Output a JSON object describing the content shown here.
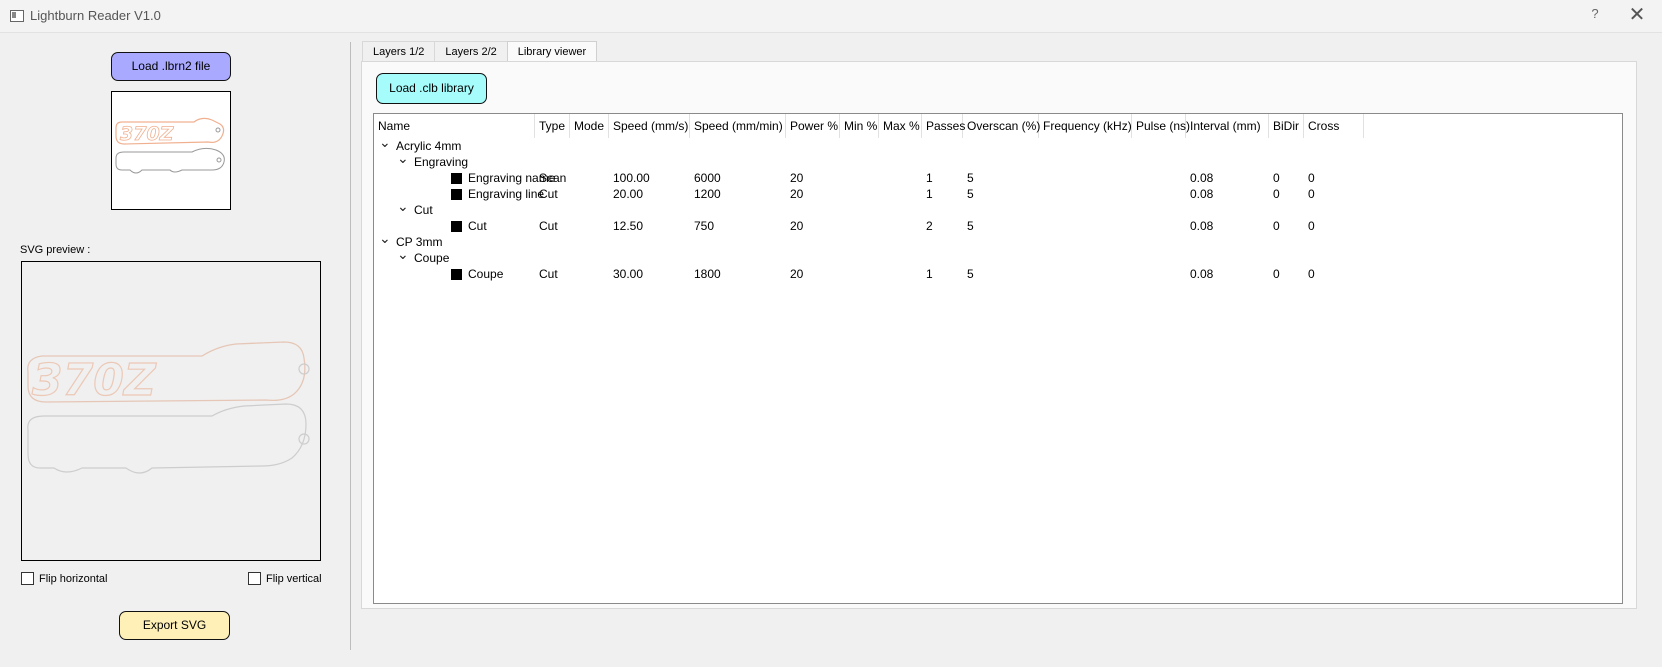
{
  "window": {
    "title": "Lightburn Reader V1.0",
    "help_label": "?",
    "close_label": "✕"
  },
  "left": {
    "load_button": "Load .lbrn2 file",
    "svg_preview_label": "SVG preview :",
    "flip_horizontal": "Flip horizontal",
    "flip_vertical": "Flip vertical",
    "export_button": "Export SVG"
  },
  "tabs": [
    {
      "label": "Layers 1/2",
      "active": false
    },
    {
      "label": "Layers 2/2",
      "active": false
    },
    {
      "label": "Library viewer",
      "active": true
    }
  ],
  "library": {
    "load_button": "Load .clb library",
    "columns": [
      "Name",
      "Type",
      "Mode",
      "Speed (mm/s)",
      "Speed (mm/min)",
      "Power %",
      "Min %",
      "Max %",
      "Passes",
      "Overscan (%)",
      "Frequency (kHz)",
      "Pulse (ns)",
      "Interval (mm)",
      "BiDir",
      "Cross"
    ],
    "rows": [
      {
        "level": 0,
        "expander": true,
        "swatch": false,
        "name": "Acrylic 4mm"
      },
      {
        "level": 1,
        "expander": true,
        "swatch": false,
        "name": "Engraving"
      },
      {
        "level": 2,
        "expander": false,
        "swatch": true,
        "name": "Engraving name",
        "type": "Scan",
        "mode": "",
        "speed_mms": "100.00",
        "speed_mmmin": "6000",
        "power": "20",
        "min": "",
        "max": "",
        "passes": "1",
        "overscan": "5",
        "frequency": "",
        "pulse": "",
        "interval": "0.08",
        "bidir": "0",
        "cross": "0"
      },
      {
        "level": 2,
        "expander": false,
        "swatch": true,
        "name": "Engraving line",
        "type": "Cut",
        "mode": "",
        "speed_mms": "20.00",
        "speed_mmmin": "1200",
        "power": "20",
        "min": "",
        "max": "",
        "passes": "1",
        "overscan": "5",
        "frequency": "",
        "pulse": "",
        "interval": "0.08",
        "bidir": "0",
        "cross": "0"
      },
      {
        "level": 1,
        "expander": true,
        "swatch": false,
        "name": "Cut"
      },
      {
        "level": 2,
        "expander": false,
        "swatch": true,
        "name": "Cut",
        "type": "Cut",
        "mode": "",
        "speed_mms": "12.50",
        "speed_mmmin": "750",
        "power": "20",
        "min": "",
        "max": "",
        "passes": "2",
        "overscan": "5",
        "frequency": "",
        "pulse": "",
        "interval": "0.08",
        "bidir": "0",
        "cross": "0"
      },
      {
        "level": 0,
        "expander": true,
        "swatch": false,
        "name": "CP 3mm"
      },
      {
        "level": 1,
        "expander": true,
        "swatch": false,
        "name": "Coupe"
      },
      {
        "level": 2,
        "expander": false,
        "swatch": true,
        "name": "Coupe",
        "type": "Cut",
        "mode": "",
        "speed_mms": "30.00",
        "speed_mmmin": "1800",
        "power": "20",
        "min": "",
        "max": "",
        "passes": "1",
        "overscan": "5",
        "frequency": "",
        "pulse": "",
        "interval": "0.08",
        "bidir": "0",
        "cross": "0"
      }
    ]
  },
  "colors": {
    "load_button_bg": "#a9aaff",
    "library_button_bg": "#a6fbfb",
    "export_button_bg": "#fff0b8",
    "logo_outline": "#f0b090"
  }
}
